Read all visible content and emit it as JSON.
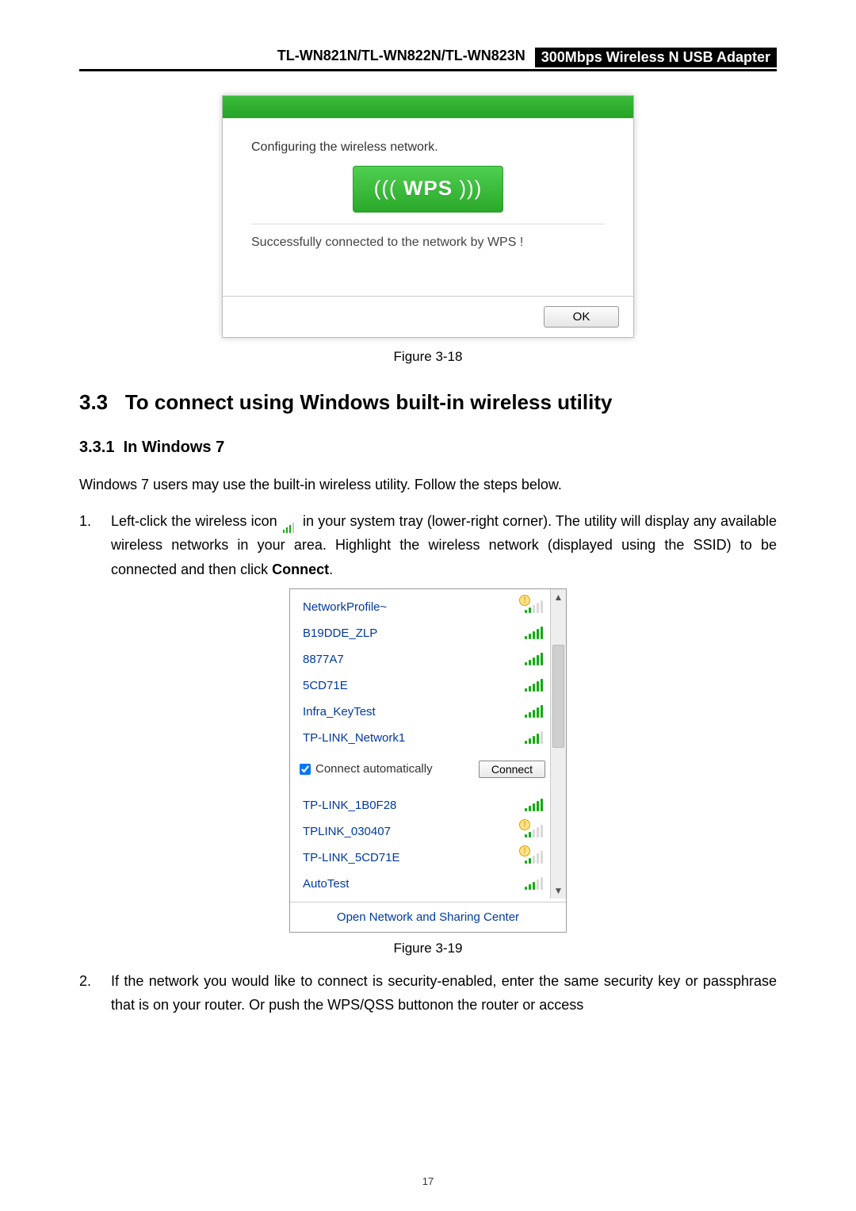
{
  "header": {
    "models": "TL-WN821N/TL-WN822N/TL-WN823N",
    "product": "300Mbps Wireless N USB Adapter"
  },
  "wps_dialog": {
    "configuring": "Configuring the wireless network.",
    "wps_label": "WPS",
    "success": "Successfully connected to the network by WPS !",
    "ok": "OK"
  },
  "fig18": "Figure 3-18",
  "section": {
    "num": "3.3",
    "title": "To connect using Windows built-in wireless utility"
  },
  "subsection": {
    "num": "3.3.1",
    "title": "In Windows 7"
  },
  "intro": "Windows 7 users may use the built-in wireless utility. Follow the steps below.",
  "step1": {
    "num": "1.",
    "part1": "Left-click the wireless icon ",
    "part2": " in your system tray (lower-right corner). The utility will display any available wireless networks in your area. Highlight the wireless network (displayed using the SSID) to be connected and then click ",
    "bold": "Connect",
    "part3": "."
  },
  "flyout": {
    "networks": [
      {
        "name": "NetworkProfile~",
        "sigClass": "s2 warn"
      },
      {
        "name": "B19DDE_ZLP",
        "sigClass": ""
      },
      {
        "name": "8877A7",
        "sigClass": ""
      },
      {
        "name": "5CD71E",
        "sigClass": ""
      },
      {
        "name": "Infra_KeyTest",
        "sigClass": ""
      },
      {
        "name": "TP-LINK_Network1",
        "sigClass": "s4"
      }
    ],
    "auto_label": "Connect automatically",
    "connect": "Connect",
    "more": [
      {
        "name": "TP-LINK_1B0F28",
        "sigClass": ""
      },
      {
        "name": "TPLINK_030407",
        "sigClass": "s2 warn"
      },
      {
        "name": "TP-LINK_5CD71E",
        "sigClass": "s2 warn"
      },
      {
        "name": "AutoTest",
        "sigClass": "s3"
      }
    ],
    "footer": "Open Network and Sharing Center"
  },
  "fig19": "Figure 3-19",
  "step2": {
    "num": "2.",
    "text": "If the network you would like to connect is security-enabled, enter the same security key or passphrase that is on your router. Or push the WPS/QSS buttonon the router or access"
  },
  "page_num": "17"
}
